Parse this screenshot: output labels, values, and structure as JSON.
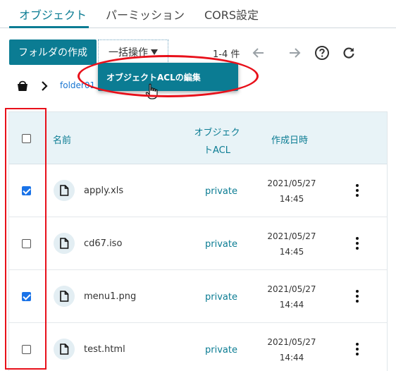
{
  "tabs": [
    {
      "label": "オブジェクト",
      "active": true
    },
    {
      "label": "パーミッション",
      "active": false
    },
    {
      "label": "CORS設定",
      "active": false
    }
  ],
  "toolbar": {
    "create_folder_label": "フォルダの作成",
    "bulk_ops_label": "一括操作",
    "count_label": "1-4 件"
  },
  "dropdown": {
    "items": [
      "オブジェクトACLの編集"
    ]
  },
  "breadcrumb": {
    "folder": "folder01"
  },
  "table": {
    "headers": {
      "name": "名前",
      "acl_line1": "オブジェク",
      "acl_line2": "トACL",
      "created": "作成日時"
    },
    "rows": [
      {
        "name": "apply.xls",
        "acl": "private",
        "date": "2021/05/27",
        "time": "14:45",
        "checked": true
      },
      {
        "name": "cd67.iso",
        "acl": "private",
        "date": "2021/05/27",
        "time": "14:45",
        "checked": false
      },
      {
        "name": "menu1.png",
        "acl": "private",
        "date": "2021/05/27",
        "time": "14:44",
        "checked": true
      },
      {
        "name": "test.html",
        "acl": "private",
        "date": "2021/05/27",
        "time": "14:44",
        "checked": false
      }
    ]
  },
  "colors": {
    "accent": "#0b7c93",
    "annotation_red": "#e8101a",
    "checkbox_blue": "#1a73e8",
    "header_bg": "#e8f3f7"
  }
}
